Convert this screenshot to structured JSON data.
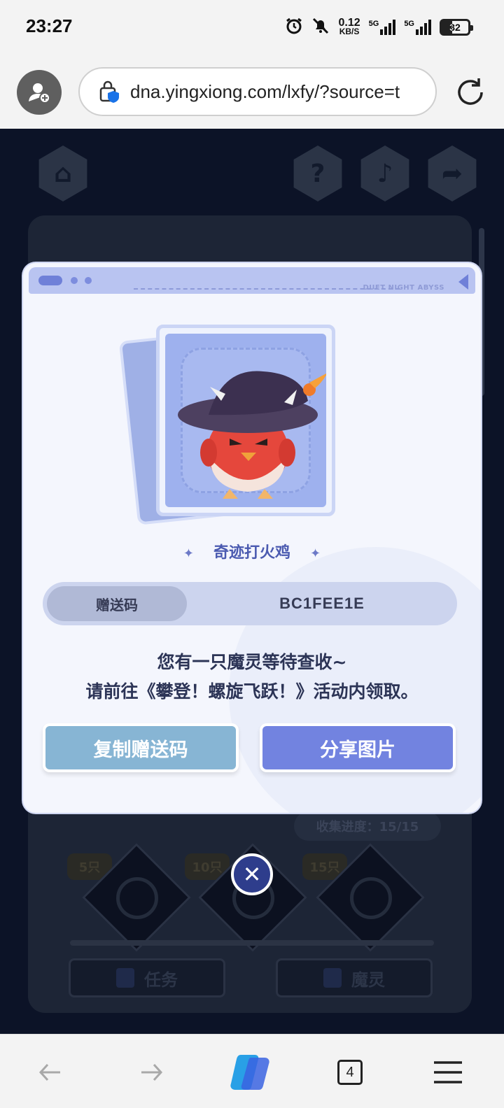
{
  "status": {
    "time": "23:27",
    "net_speed_value": "0.12",
    "net_speed_unit": "KB/S",
    "network_1": "5G",
    "network_2": "5G",
    "battery": "32"
  },
  "browser": {
    "url": "dna.yingxiong.com/lxfy/?source=t",
    "tab_count": "4"
  },
  "modal": {
    "brand": "DUET NIGHT ABYSS",
    "pet_name": "奇迹打火鸡",
    "code_label": "赠送码",
    "code_value": "BC1FEE1E",
    "message_line1": "您有一只魔灵等待查收~",
    "message_line2": "请前往《攀登！螺旋飞跃！》活动内领取。",
    "copy_button": "复制赠送码",
    "share_button": "分享图片"
  },
  "background": {
    "progress": "收集进度：15/15",
    "milestones": [
      "5只",
      "10只",
      "15只"
    ],
    "tab_tasks": "任务",
    "tab_spirits": "魔灵"
  },
  "colors": {
    "accent": "#7283e0",
    "copy_button": "#87b5d4",
    "page_background": "#0c1327"
  }
}
